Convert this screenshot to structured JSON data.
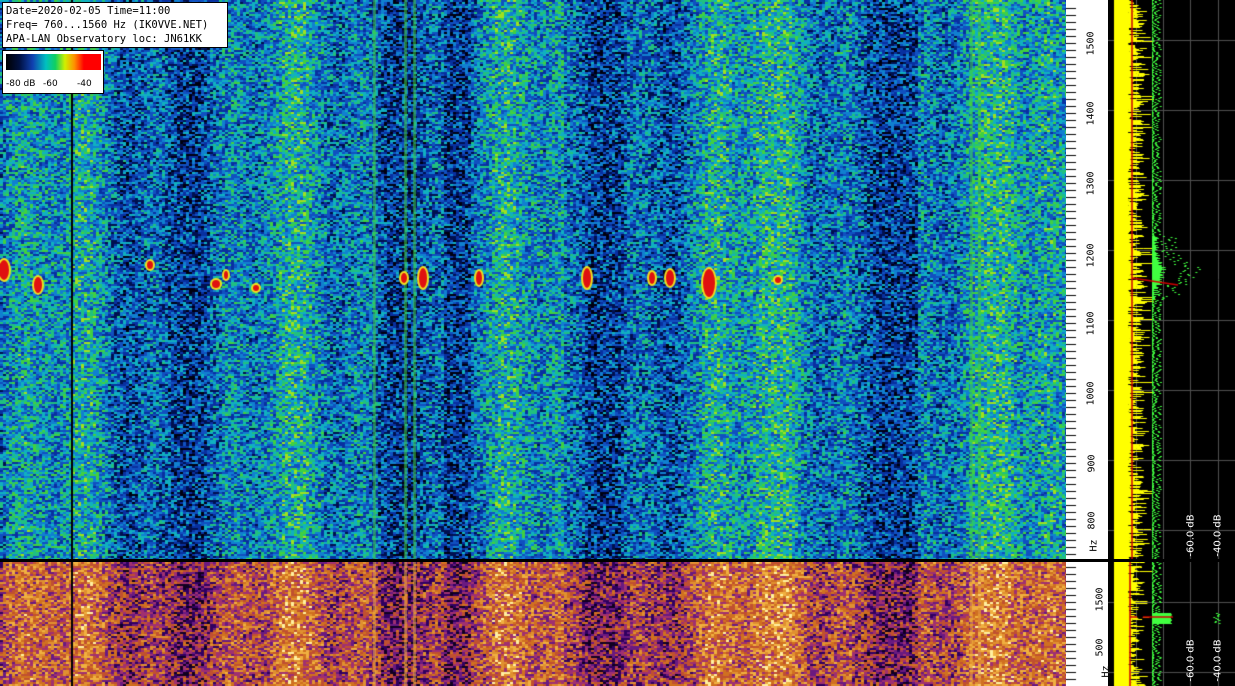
{
  "info": {
    "line1": "Date=2020-02-05 Time=11:00",
    "line2": "Freq= 760...1560 Hz (IK0VVE.NET)",
    "line3": "APA-LAN Observatory loc: JN61KK"
  },
  "scale": {
    "label_a": "-80 dB",
    "label_b": "-60",
    "label_c": "-40"
  },
  "axis_top": {
    "ticks": [
      "1500",
      "1400",
      "1300",
      "1200",
      "1100",
      "1000",
      "900",
      "800"
    ],
    "unit": "Hz"
  },
  "axis_bottom": {
    "ticks": [
      "1500",
      "500"
    ],
    "unit": "Hz"
  },
  "spectrum_top": {
    "db_labels": [
      "-60.0 dB",
      "-40.0 dB"
    ]
  },
  "spectrum_bottom": {
    "db_labels": [
      "-60.0 dB",
      "-40.0 dB"
    ]
  },
  "colors": {
    "trace": "#ffff00",
    "peak_trace": "#40ff40",
    "marker": "#cc0000"
  }
}
